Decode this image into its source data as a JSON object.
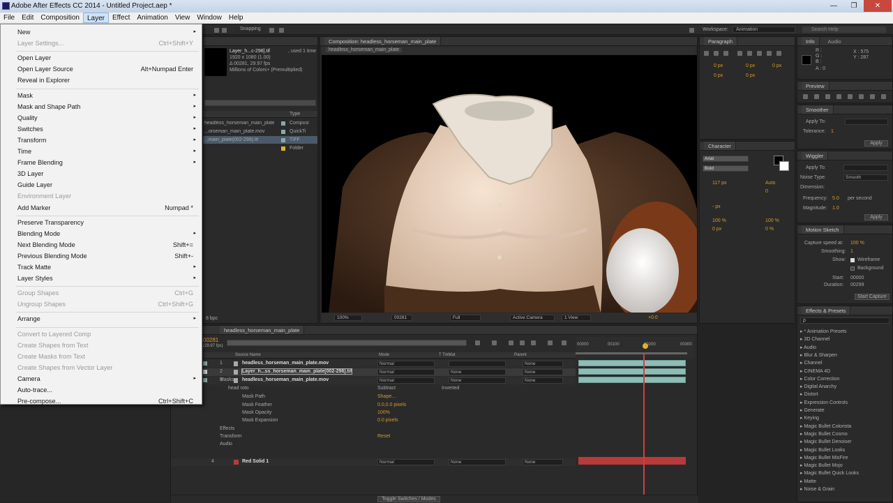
{
  "window": {
    "title": "Adobe After Effects CC 2014 - Untitled Project.aep *",
    "min": "—",
    "max": "❐",
    "close": "✕"
  },
  "menubar": [
    "File",
    "Edit",
    "Composition",
    "Layer",
    "Effect",
    "Animation",
    "View",
    "Window",
    "Help"
  ],
  "toolbar": {
    "snapping": "Snapping",
    "workspace_label": "Workspace:",
    "workspace_value": "Animation",
    "search_placeholder": "Search Help"
  },
  "layer_menu": [
    {
      "label": "New",
      "shortcut": "",
      "submenu": true,
      "disabled": false
    },
    {
      "label": "Layer Settings...",
      "shortcut": "Ctrl+Shift+Y",
      "submenu": false,
      "disabled": true
    },
    {
      "sep": true
    },
    {
      "label": "Open Layer",
      "shortcut": "",
      "submenu": false,
      "disabled": false
    },
    {
      "label": "Open Layer Source",
      "shortcut": "Alt+Numpad Enter",
      "submenu": false,
      "disabled": false
    },
    {
      "label": "Reveal in Explorer",
      "shortcut": "",
      "submenu": false,
      "disabled": false
    },
    {
      "sep": true
    },
    {
      "label": "Mask",
      "shortcut": "",
      "submenu": true,
      "disabled": false
    },
    {
      "label": "Mask and Shape Path",
      "shortcut": "",
      "submenu": true,
      "disabled": false
    },
    {
      "label": "Quality",
      "shortcut": "",
      "submenu": true,
      "disabled": false
    },
    {
      "label": "Switches",
      "shortcut": "",
      "submenu": true,
      "disabled": false
    },
    {
      "label": "Transform",
      "shortcut": "",
      "submenu": true,
      "disabled": false
    },
    {
      "label": "Time",
      "shortcut": "",
      "submenu": true,
      "disabled": false
    },
    {
      "label": "Frame Blending",
      "shortcut": "",
      "submenu": true,
      "disabled": false
    },
    {
      "label": "3D Layer",
      "shortcut": "",
      "submenu": false,
      "disabled": false
    },
    {
      "label": "Guide Layer",
      "shortcut": "",
      "submenu": false,
      "disabled": false
    },
    {
      "label": "Environment Layer",
      "shortcut": "",
      "submenu": false,
      "disabled": true
    },
    {
      "label": "Add Marker",
      "shortcut": "Numpad *",
      "submenu": false,
      "disabled": false
    },
    {
      "sep": true
    },
    {
      "label": "Preserve Transparency",
      "shortcut": "",
      "submenu": false,
      "disabled": false
    },
    {
      "label": "Blending Mode",
      "shortcut": "",
      "submenu": true,
      "disabled": false
    },
    {
      "label": "Next Blending Mode",
      "shortcut": "Shift+=",
      "submenu": false,
      "disabled": false
    },
    {
      "label": "Previous Blending Mode",
      "shortcut": "Shift+-",
      "submenu": false,
      "disabled": false
    },
    {
      "label": "Track Matte",
      "shortcut": "",
      "submenu": true,
      "disabled": false
    },
    {
      "label": "Layer Styles",
      "shortcut": "",
      "submenu": true,
      "disabled": false
    },
    {
      "sep": true
    },
    {
      "label": "Group Shapes",
      "shortcut": "Ctrl+G",
      "submenu": false,
      "disabled": true
    },
    {
      "label": "Ungroup Shapes",
      "shortcut": "Ctrl+Shift+G",
      "submenu": false,
      "disabled": true
    },
    {
      "sep": true
    },
    {
      "label": "Arrange",
      "shortcut": "",
      "submenu": true,
      "disabled": false
    },
    {
      "sep": true
    },
    {
      "label": "Convert to Layered Comp",
      "shortcut": "",
      "submenu": false,
      "disabled": true
    },
    {
      "label": "Create Shapes from Text",
      "shortcut": "",
      "submenu": false,
      "disabled": true
    },
    {
      "label": "Create Masks from Text",
      "shortcut": "",
      "submenu": false,
      "disabled": true
    },
    {
      "label": "Create Shapes from Vector Layer",
      "shortcut": "",
      "submenu": false,
      "disabled": true
    },
    {
      "label": "Camera",
      "shortcut": "",
      "submenu": true,
      "disabled": false
    },
    {
      "label": "Auto-trace...",
      "shortcut": "",
      "submenu": false,
      "disabled": false
    },
    {
      "label": "Pre-compose...",
      "shortcut": "Ctrl+Shift+C",
      "submenu": false,
      "disabled": false
    }
  ],
  "project": {
    "selected_name": "Layer_h...c-298].tif",
    "used": ", used 1 time",
    "dims": "1920 x 1080 (1.00)",
    "time": "Δ 00281, 29.97 fps",
    "colors": "Millions of Colors+ (Premultiplied)",
    "col_type": "Type",
    "items": [
      {
        "name": "headless_horseman_main_plate",
        "type": "Composi"
      },
      {
        "name": "...orseman_main_plate.mov",
        "type": "QuickTi"
      },
      {
        "name": "...main_plate[002-298].tif",
        "type": "TIFF"
      },
      {
        "name": "",
        "type": "Folder"
      }
    ],
    "bpc": "8 bpc"
  },
  "composition": {
    "tab": "Composition: headless_horseman_main_plate",
    "subtab": "headless_horseman_main_plate",
    "zoom": "100%",
    "timecode": "00281",
    "resolution": "Full",
    "camera": "Active Camera",
    "view": "1 View",
    "exposure": "+0.0"
  },
  "paragraph": {
    "title": "Paragraph",
    "vals": [
      "0 px",
      "0 px",
      "0 px",
      "0 px",
      "0 px"
    ]
  },
  "character": {
    "title": "Character",
    "font": "Arial",
    "style": "Bold",
    "size": "117 px",
    "leading": "Auto",
    "tracking": "0",
    "stroke": "- px",
    "scale_v": "100 %",
    "scale_h": "100 %",
    "baseline": "0 px",
    "tsume": "0 %"
  },
  "info": {
    "title": "Info",
    "tab2": "Audio",
    "r": "R :",
    "g": "G :",
    "b": "B :",
    "a": "A : 0",
    "x": "X : 575",
    "y": "Y : 287"
  },
  "preview": {
    "title": "Preview"
  },
  "smoother": {
    "title": "Smoother",
    "apply_to": "Apply To:",
    "tolerance_label": "Tolerance:",
    "tolerance": "1",
    "apply": "Apply"
  },
  "wiggler": {
    "title": "Wiggler",
    "apply_to": "Apply To:",
    "noise_type": "Noise Type:",
    "noise_value": "Smooth",
    "dimension": "Dimension:",
    "frequency_label": "Frequency:",
    "frequency": "5.0",
    "per_second": "per second",
    "magnitude_label": "Magnitude:",
    "magnitude": "1.0",
    "apply": "Apply"
  },
  "motion_sketch": {
    "title": "Motion Sketch",
    "capture_label": "Capture speed at:",
    "capture": "100 %",
    "smoothing_label": "Smoothing:",
    "smoothing": "1",
    "show": "Show:",
    "wireframe": "Wireframe",
    "background": "Background",
    "start_label": "Start:",
    "start": "00000",
    "duration_label": "Duration:",
    "duration": "00299",
    "start_capture": "Start Capture"
  },
  "effects": {
    "title": "Effects & Presets",
    "search": "ρ",
    "items": [
      "* Animation Presets",
      "3D Channel",
      "Audio",
      "Blur & Sharpen",
      "Channel",
      "CINEMA 4D",
      "Color Correction",
      "Digital Anarchy",
      "Distort",
      "Expression Controls",
      "Generate",
      "Keying",
      "Magic Bullet Colorista",
      "Magic Bullet Cosmo",
      "Magic Bullet Denoiser",
      "Magic Bullet Looks",
      "Magic Bullet MisFire",
      "Magic Bullet Mojo",
      "Magic Bullet Quick Looks",
      "Matte",
      "Noise & Grain"
    ]
  },
  "timeline": {
    "tab": "headless_horseman_main_plate",
    "timecode": "00281",
    "fps": "(29.97 fps)",
    "cols": {
      "source": "Source Name",
      "mode": "Mode",
      "trk": "T TrkMat",
      "parent": "Parent"
    },
    "ruler": [
      "00000",
      "00100",
      "00200",
      "00300"
    ],
    "layers": [
      {
        "num": "1",
        "name": "headless_horseman_main_plate.mov",
        "mode": "Normal",
        "trk": "",
        "parent": "None"
      },
      {
        "num": "2",
        "name": "Layer_h...ss_horseman_main_plate[002-298].tif",
        "mode": "Normal",
        "trk": "None",
        "parent": "None"
      },
      {
        "num": "3",
        "name": "headless_horseman_main_plate.mov",
        "mode": "Normal",
        "trk": "None",
        "parent": "None"
      }
    ],
    "props": {
      "masks": "Masks",
      "mask1": "head roto",
      "mask1_mode": "Subtract",
      "inverted": "Inverted",
      "mask_path": "Mask Path",
      "mask_path_v": "Shape...",
      "mask_feather": "Mask Feather",
      "mask_feather_v": "0.0,0.0 pixels",
      "mask_opacity": "Mask Opacity",
      "mask_opacity_v": "100%",
      "mask_expansion": "Mask Expansion",
      "mask_expansion_v": "0.0 pixels",
      "effects": "Effects",
      "transform": "Transform",
      "transform_v": "Reset",
      "audio": "Audio"
    },
    "layer4": {
      "num": "4",
      "name": "Red Solid 1",
      "mode": "Normal",
      "trk": "None",
      "parent": "None"
    },
    "footer": "Toggle Switches / Modes"
  },
  "colors": {
    "accent_orange": "#d59a2a",
    "track_teal": "#8ebdb6",
    "red_track": "#b83a3a",
    "menu_highlight": "#cde3f8"
  }
}
